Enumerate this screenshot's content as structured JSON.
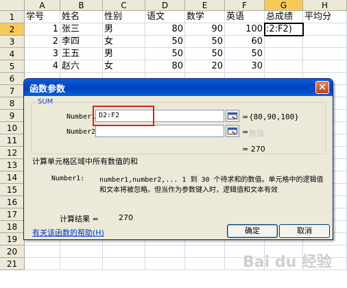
{
  "columns": [
    "A",
    "B",
    "C",
    "D",
    "E",
    "F",
    "G",
    "H"
  ],
  "rows": [
    "1",
    "2",
    "3",
    "4",
    "5",
    "6",
    "7",
    "8",
    "9",
    "10",
    "11",
    "12",
    "13",
    "14",
    "15",
    "16",
    "17",
    "18",
    "19",
    "20",
    "21"
  ],
  "active_column": "G",
  "active_row": "2",
  "header_row": [
    "学号",
    "姓名",
    "性别",
    "语文",
    "数学",
    "英语",
    "总成绩",
    "平均分"
  ],
  "data_rows": [
    [
      "1",
      "张三",
      "男",
      "80",
      "90",
      "100",
      ":2:F2)",
      ""
    ],
    [
      "2",
      "李四",
      "女",
      "50",
      "50",
      "60",
      "",
      ""
    ],
    [
      "3",
      "王五",
      "男",
      "50",
      "50",
      "50",
      "",
      ""
    ],
    [
      "4",
      "赵六",
      "女",
      "80",
      "20",
      "30",
      "",
      ""
    ]
  ],
  "dialog": {
    "title": "函数参数",
    "close_label": "×",
    "function_name": "SUM",
    "arg1_label": "Number1",
    "arg1_value": "D2:F2",
    "arg1_result": "{80,90,100}",
    "arg2_label": "Number2",
    "arg2_value": "",
    "arg2_result": "数值",
    "equals": "=",
    "formula_result": "= 270",
    "description": "计算单元格区域中所有数值的和",
    "arg_desc_name": "Number1:",
    "arg_desc_text": "number1,number2,... 1 到 30 个待求和的数值。单元格中的逻辑值和文本将被忽略。但当作为参数键入时，逻辑值和文本有效",
    "calc_label": "计算结果 =",
    "calc_value": "270",
    "help_link": "有关该函数的帮助(H)",
    "ok_label": "确定",
    "cancel_label": "取消"
  },
  "watermark": "Bai du 经验",
  "colors": {
    "title_bar": "#0a5fd8",
    "highlight": "#d81e1e",
    "dialog_bg": "#ece9d8",
    "header_active": "#f7c95b"
  }
}
